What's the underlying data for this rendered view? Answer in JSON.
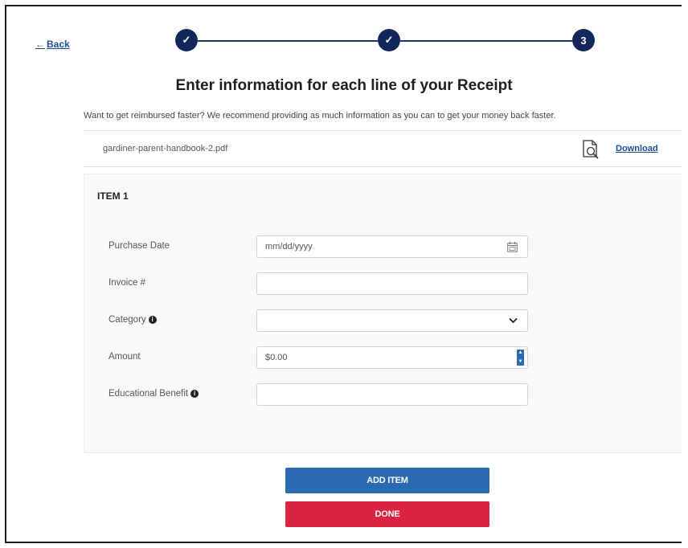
{
  "nav": {
    "back_label": "Back",
    "back_arrow": "←"
  },
  "stepper": {
    "steps": [
      {
        "state": "complete",
        "label": "✓"
      },
      {
        "state": "complete",
        "label": "✓"
      },
      {
        "state": "current",
        "label": "3"
      }
    ],
    "color": "#13285a"
  },
  "header": {
    "title": "Enter information for each line of your Receipt",
    "subtitle": "Want to get reimbursed faster? We recommend providing as much information as you can to get your money back faster."
  },
  "file": {
    "name": "gardiner-parent-handbook-2.pdf",
    "download_label": "Download",
    "icon": "document-search-icon"
  },
  "item": {
    "title": "ITEM 1",
    "fields": {
      "purchase_date": {
        "label": "Purchase Date",
        "placeholder": "mm/dd/yyyy",
        "value": ""
      },
      "invoice": {
        "label": "Invoice #",
        "value": ""
      },
      "category": {
        "label": "Category",
        "info_icon": "i",
        "value": ""
      },
      "amount": {
        "label": "Amount",
        "value": "$0.00"
      },
      "educational_benefit": {
        "label": "Educational Benefit",
        "info_icon": "i",
        "value": ""
      }
    }
  },
  "actions": {
    "add_item_label": "ADD ITEM",
    "done_label": "DONE"
  },
  "colors": {
    "primary": "#2a6ab0",
    "danger": "#dc2340",
    "link": "#1b4f8f"
  }
}
